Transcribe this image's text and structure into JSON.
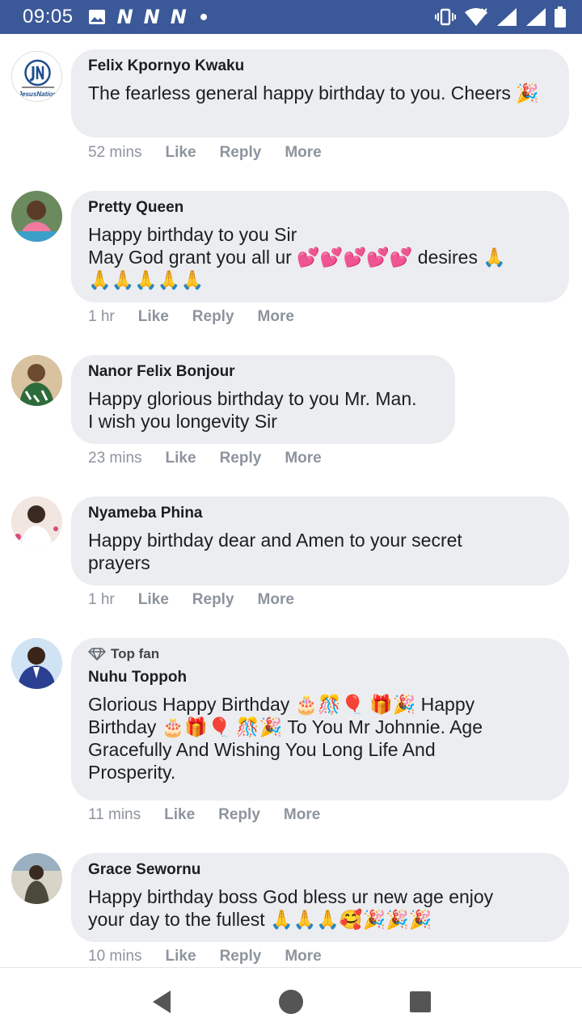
{
  "status_bar": {
    "time": "09:05",
    "notification_letter": "N",
    "icons": [
      "image-icon",
      "n-app-icon",
      "n-app-icon",
      "n-app-icon",
      "dot-icon",
      "vibrate-icon",
      "wifi-icon",
      "signal-icon",
      "signal-icon",
      "battery-icon"
    ]
  },
  "comments": [
    {
      "author": "Felix Kpornyo Kwaku",
      "text": "The fearless general happy birthday to you. Cheers 🎉",
      "time": "52 mins",
      "like": "Like",
      "reply": "Reply",
      "more": "More",
      "avatar_text": "JesusNation",
      "avatar_colors": [
        "#ffffff",
        "#1f4e8c"
      ]
    },
    {
      "author": "Pretty Queen",
      "text": "Happy birthday to you Sir\nMay God grant you all ur 💕💕💕💕💕 desires 🙏\n🙏🙏🙏🙏🙏",
      "time": "1 hr",
      "like": "Like",
      "reply": "Reply",
      "more": "More",
      "avatar_colors": [
        "#5a3b2a",
        "#3aa0c8"
      ]
    },
    {
      "author": "Nanor Felix Bonjour",
      "text": "Happy glorious birthday to you Mr. Man.\nI wish you longevity Sir",
      "time": "23 mins",
      "like": "Like",
      "reply": "Reply",
      "more": "More",
      "avatar_colors": [
        "#b98a5a",
        "#2e6b3a"
      ]
    },
    {
      "author": "Nyameba Phina",
      "text": "Happy birthday dear and Amen to your secret\nprayers",
      "time": "1 hr",
      "like": "Like",
      "reply": "Reply",
      "more": "More",
      "avatar_colors": [
        "#f2e6e0",
        "#d94b7a"
      ]
    },
    {
      "badge": "Top fan",
      "author": "Nuhu Toppoh",
      "text": "Glorious Happy Birthday 🎂🎊🎈 🎁🎉 Happy\nBirthday 🎂🎁🎈 🎊🎉 To You Mr Johnnie. Age\nGracefully And Wishing You Long Life And\nProsperity.",
      "time": "11 mins",
      "like": "Like",
      "reply": "Reply",
      "more": "More",
      "avatar_colors": [
        "#cfe3f5",
        "#2a3f8f"
      ]
    },
    {
      "author": "Grace Sewornu",
      "text": "Happy birthday boss God bless ur new age enjoy\nyour day to the fullest 🙏🙏🙏🥰🎉🎉🎉",
      "time": "10 mins",
      "like": "Like",
      "reply": "Reply",
      "more": "More",
      "avatar_colors": [
        "#d9d4c8",
        "#4a4a3a"
      ]
    }
  ],
  "nav": {
    "back": "back-icon",
    "home": "home-icon",
    "recents": "recents-icon"
  }
}
